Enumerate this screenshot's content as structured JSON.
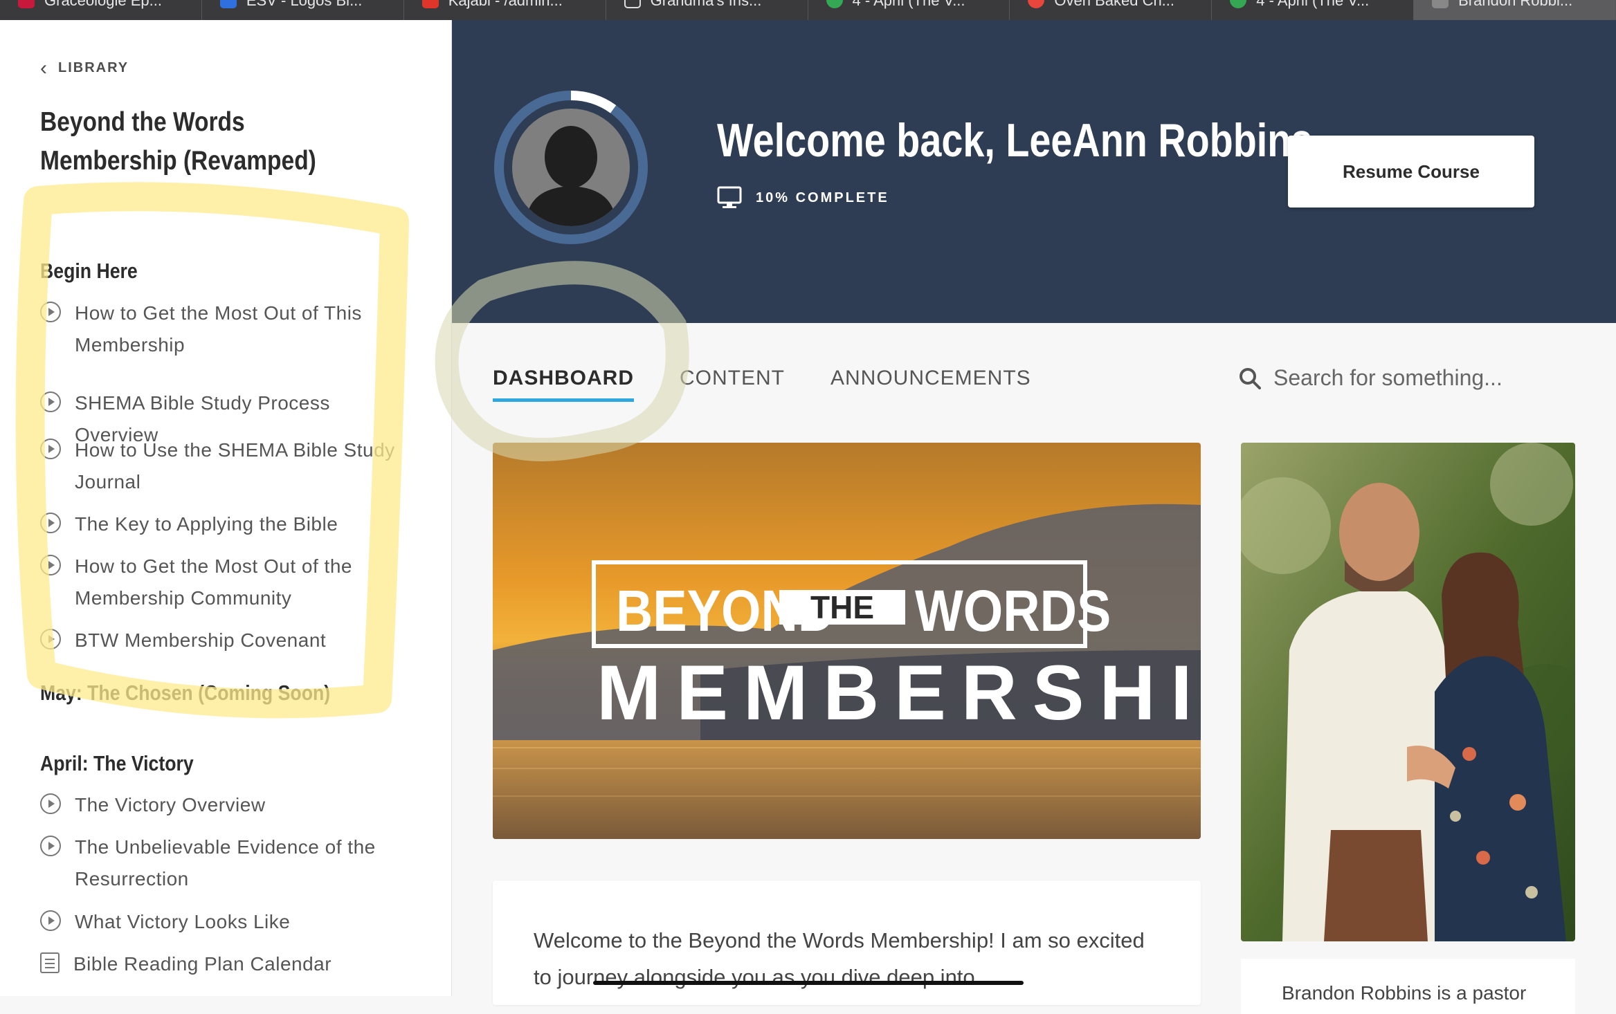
{
  "browser_tabs": [
    {
      "label": "Graceologie Ep...",
      "color": "#c8183c"
    },
    {
      "label": "ESV - Logos Bi...",
      "color": "#2f6fe0"
    },
    {
      "label": "Kajabi - /admin...",
      "color": "#e0352b"
    },
    {
      "label": "Grandma's Ins...",
      "color": "#666666"
    },
    {
      "label": "4 - April (The V...",
      "color": "#34a853"
    },
    {
      "label": "Oven Baked Ch...",
      "color": "#e8453c"
    },
    {
      "label": "4 - April (The V...",
      "color": "#34a853"
    },
    {
      "label": "Brandon Robbi...",
      "color": "#888888"
    }
  ],
  "sidebar": {
    "library_label": "LIBRARY",
    "course_title": "Beyond the Words Membership (Revamped)",
    "sections": [
      {
        "title": "Begin Here",
        "lessons": [
          {
            "label": "How to Get the Most Out of This Membership",
            "icon": "play-circle-icon"
          },
          {
            "label": "SHEMA Bible Study Process Overview",
            "icon": "play-circle-icon"
          },
          {
            "label": "How to Use the SHEMA Bible Study Journal",
            "icon": "play-circle-icon"
          },
          {
            "label": "The Key to Applying the Bible",
            "icon": "play-circle-icon"
          },
          {
            "label": "How to Get the Most Out of the Membership Community",
            "icon": "play-circle-icon"
          },
          {
            "label": "BTW Membership Covenant",
            "icon": "play-circle-icon"
          }
        ]
      },
      {
        "title": "May: The Chosen (Coming Soon)",
        "lessons": []
      },
      {
        "title": "April: The Victory",
        "lessons": [
          {
            "label": "The Victory Overview",
            "icon": "play-circle-icon"
          },
          {
            "label": "The Unbelievable Evidence of the Resurrection",
            "icon": "play-circle-icon"
          },
          {
            "label": "What Victory Looks Like",
            "icon": "play-circle-icon"
          },
          {
            "label": "Bible Reading Plan Calendar",
            "icon": "document-icon"
          }
        ]
      }
    ]
  },
  "hero": {
    "welcome": "Welcome back, LeeAnn Robbins",
    "progress_text": "10% COMPLETE",
    "progress_fraction": 0.1,
    "resume_label": "Resume Course"
  },
  "nav_tabs": [
    {
      "label": "DASHBOARD",
      "active": true
    },
    {
      "label": "CONTENT",
      "active": false
    },
    {
      "label": "ANNOUNCEMENTS",
      "active": false
    }
  ],
  "search": {
    "placeholder": "Search for something..."
  },
  "banner": {
    "line1_left": "BEYOND",
    "line1_mid": "THE",
    "line1_right": "WORDS",
    "line2": "MEMBERSHIP"
  },
  "welcome_card": {
    "text": "Welcome to the Beyond the Words Membership! I am so excited to journey alongside you as you dive deep into"
  },
  "bio_card": {
    "text": "Brandon Robbins is a pastor"
  },
  "colors": {
    "hero_bg": "#2e3d53",
    "accent": "#2ea8df",
    "highlight": "#fde98c"
  }
}
